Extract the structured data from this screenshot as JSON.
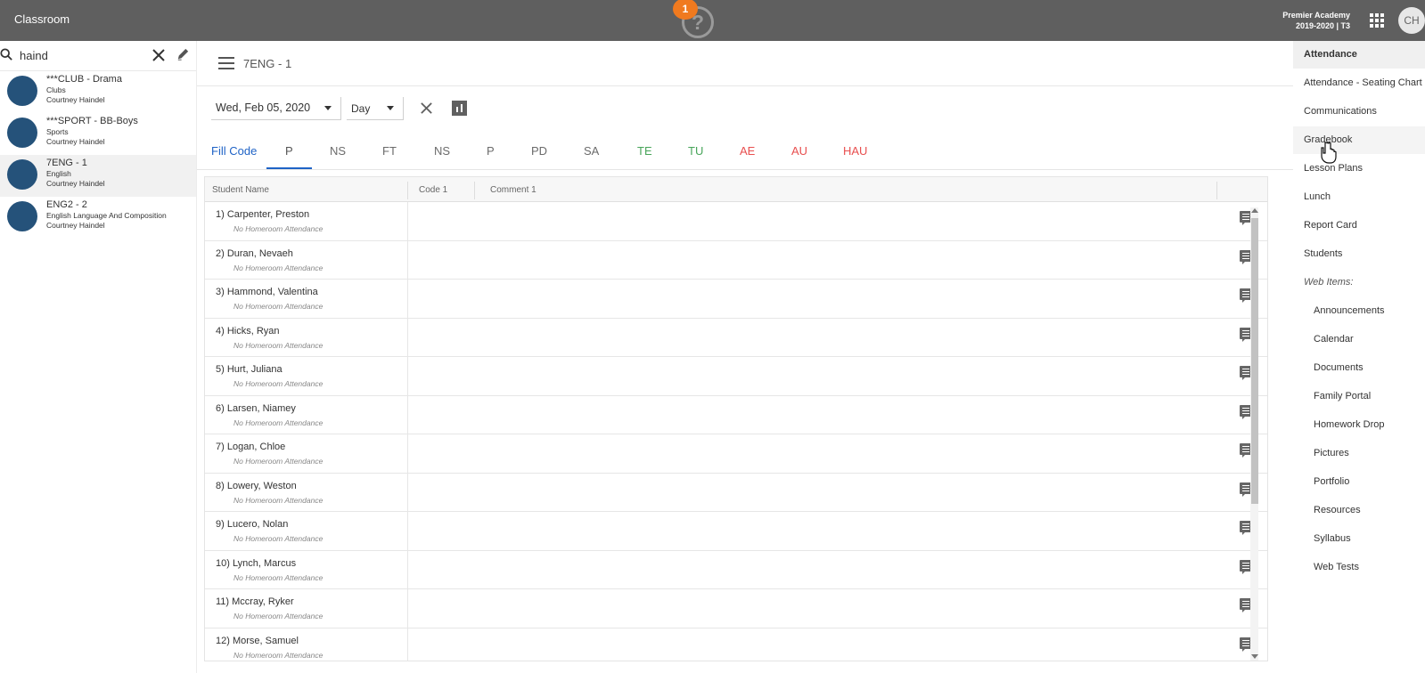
{
  "app": {
    "title": "Classroom",
    "notification_count": "1",
    "help_symbol": "?",
    "school_name": "Premier Academy",
    "term": "2019-2020 | T3",
    "user_initials": "CH"
  },
  "search": {
    "value": "haind"
  },
  "classes": [
    {
      "name": "***CLUB - Drama",
      "type": "Clubs",
      "teacher": "Courtney Haindel"
    },
    {
      "name": "***SPORT - BB-Boys",
      "type": "Sports",
      "teacher": "Courtney Haindel"
    },
    {
      "name": "7ENG - 1",
      "type": "English",
      "teacher": "Courtney Haindel"
    },
    {
      "name": "ENG2 - 2",
      "type": "English Language And Composition",
      "teacher": "Courtney Haindel"
    }
  ],
  "course": {
    "title": "7ENG - 1"
  },
  "filters": {
    "date": "Wed, Feb 05, 2020",
    "period": "Day"
  },
  "codes": [
    "Fill Code",
    "P",
    "NS",
    "FT",
    "NS",
    "P",
    "PD",
    "SA",
    "TE",
    "TU",
    "AE",
    "AU",
    "HAU"
  ],
  "table": {
    "headers": [
      "Student Name",
      "Code 1",
      "Comment 1"
    ],
    "students": [
      {
        "name": "1) Carpenter, Preston",
        "note": "No Homeroom Attendance"
      },
      {
        "name": "2) Duran, Nevaeh",
        "note": "No Homeroom Attendance"
      },
      {
        "name": "3) Hammond, Valentina",
        "note": "No Homeroom Attendance"
      },
      {
        "name": "4) Hicks, Ryan",
        "note": "No Homeroom Attendance"
      },
      {
        "name": "5) Hurt, Juliana",
        "note": "No Homeroom Attendance"
      },
      {
        "name": "6) Larsen, Niamey",
        "note": "No Homeroom Attendance"
      },
      {
        "name": "7) Logan, Chloe",
        "note": "No Homeroom Attendance"
      },
      {
        "name": "8) Lowery, Weston",
        "note": "No Homeroom Attendance"
      },
      {
        "name": "9) Lucero, Nolan",
        "note": "No Homeroom Attendance"
      },
      {
        "name": "10) Lynch, Marcus",
        "note": "No Homeroom Attendance"
      },
      {
        "name": "11) Mccray, Ryker",
        "note": "No Homeroom Attendance"
      },
      {
        "name": "12) Morse, Samuel",
        "note": "No Homeroom Attendance"
      }
    ]
  },
  "navigation": [
    "Attendance",
    "Attendance - Seating Chart",
    "Communications",
    "Gradebook",
    "Lesson Plans",
    "Lunch",
    "Report Card",
    "Students",
    "Web Items:",
    "Announcements",
    "Calendar",
    "Documents",
    "Family Portal",
    "Homework Drop",
    "Pictures",
    "Portfolio",
    "Resources",
    "Syllabus",
    "Web Tests"
  ]
}
